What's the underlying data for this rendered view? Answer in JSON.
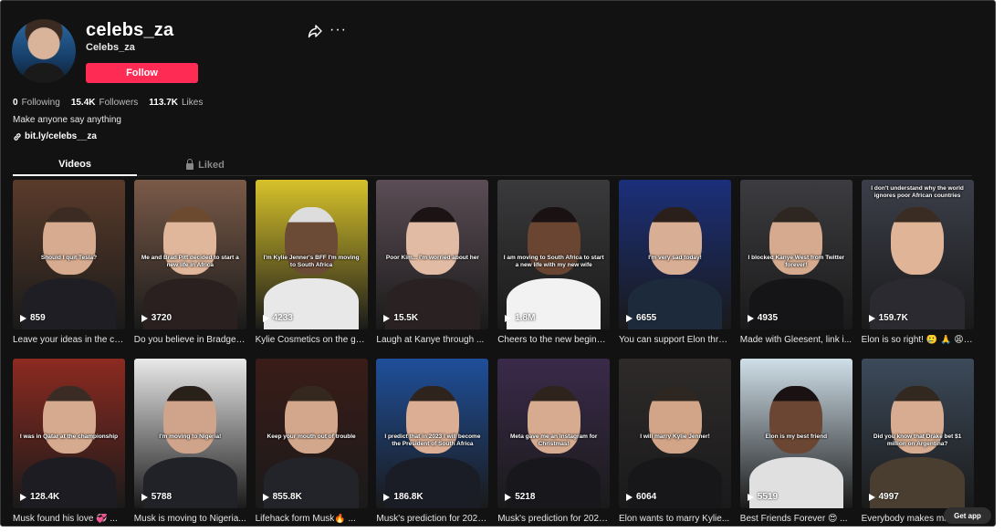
{
  "profile": {
    "username": "celebs_za",
    "nickname": "Celebs_za",
    "follow_label": "Follow",
    "following_count": "0",
    "following_label": "Following",
    "followers_count": "15.4K",
    "followers_label": "Followers",
    "likes_count": "113.7K",
    "likes_label": "Likes",
    "bio": "Make anyone say anything",
    "link": "bit.ly/celebs__za"
  },
  "tabs": {
    "videos": "Videos",
    "liked": "Liked"
  },
  "more_glyph": "···",
  "get_app": "Get app",
  "colors": {
    "accent": "#fe2c55",
    "background": "#121212"
  },
  "videos": [
    {
      "views": "859",
      "title": "Leave your ideas in the co...",
      "overlay": "Should I quit Tesla?",
      "bg": "#5a3b2a",
      "skin": "#d6ab90",
      "hair": "#3b2b22",
      "shirt": "#1e1e24"
    },
    {
      "views": "3720",
      "title": "Do you believe in Bradgeli...",
      "overlay": "Me and Brad Pitt decided to start a new life in Africa",
      "bg": "#7a5a48",
      "skin": "#e1b79b",
      "hair": "#6b4a30",
      "shirt": "#2a2020"
    },
    {
      "views": "4233",
      "title": "Kylie Cosmetics on the gol...",
      "overlay": "I'm Kylie Jenner's BFF I'm moving to South Africa",
      "bg": "#d7c22a",
      "skin": "#6b4a36",
      "hair": "#ddd",
      "shirt": "#e8e8e8"
    },
    {
      "views": "15.5K",
      "title": "Laugh at Kanye through ...",
      "overlay": "Poor Kim... I'm worried about her",
      "bg": "#5b4d55",
      "skin": "#e2bba4",
      "hair": "#1c1414",
      "shirt": "#2a2222"
    },
    {
      "views": "1.8M",
      "title": "Cheers to the new beginni...",
      "overlay": "I am moving to South Africa to start a new life with my new wife",
      "bg": "#3a3a3c",
      "skin": "#6a4632",
      "hair": "#1a1212",
      "shirt": "#f2f2f2"
    },
    {
      "views": "6655",
      "title": "You can support Elon thro...",
      "overlay": "I'm very sad today!",
      "bg": "#1b2f7a",
      "skin": "#d8ae95",
      "hair": "#2a1f1a",
      "shirt": "#1c2a3c"
    },
    {
      "views": "4935",
      "title": "Made with Gleesent, link i...",
      "overlay": "I blocked Kanye West from Twitter forever!",
      "bg": "#3c3c40",
      "skin": "#d5aa8f",
      "hair": "#2e2620",
      "shirt": "#151518"
    },
    {
      "views": "159.7K",
      "title": "Elon is so right! 🥲 🙏 😩 ...",
      "overlay": "I don't understand why the world ignores poor African countries",
      "bg": "#3c3f4a",
      "skin": "#e0b497",
      "hair": "#3a2c22",
      "shirt": "#2a2a30",
      "overlay_top": true
    },
    {
      "views": "128.4K",
      "title": "Musk found his love 💞 ...",
      "overlay": "I was in Qatar at the championship",
      "bg": "#8c2a20",
      "skin": "#d6aa8e",
      "hair": "#3a2c24",
      "shirt": "#1c1c22"
    },
    {
      "views": "5788",
      "title": "Musk is moving to Nigeria...",
      "overlay": "I'm moving to Nigeria!",
      "bg": "#e9e9ea",
      "skin": "#d0a48a",
      "hair": "#2a201a",
      "shirt": "#202228"
    },
    {
      "views": "855.8K",
      "title": "Lifehack form Musk🔥 ...",
      "overlay": "Keep your mouth out of trouble",
      "bg": "#3a1c18",
      "skin": "#d3a78c",
      "hair": "#35281f",
      "shirt": "#23232a"
    },
    {
      "views": "186.8K",
      "title": "Musk's prediction for 2023...",
      "overlay": "I predict that in 2023 I will become the President of South Africa",
      "bg": "#1f4f9a",
      "skin": "#dcae93",
      "hair": "#2e241d",
      "shirt": "#1b1d26"
    },
    {
      "views": "5218",
      "title": "Musk's prediction for 2023...",
      "overlay": "Meta gave me an Instagram for Christmas!",
      "bg": "#3a2a4a",
      "skin": "#d7ab8f",
      "hair": "#2e241d",
      "shirt": "#17171c"
    },
    {
      "views": "6064",
      "title": "Elon wants to marry Kylie...",
      "overlay": "I will marry Kylie Jenner!",
      "bg": "#2e2a2a",
      "skin": "#d2a588",
      "hair": "#2e2620",
      "shirt": "#17171a"
    },
    {
      "views": "5519",
      "title": "Best Friends Forever 😍 ...",
      "overlay": "Elon is my best friend",
      "bg": "#cfdfe8",
      "skin": "#6b4633",
      "hair": "#1a1212",
      "shirt": "#e0e0e0"
    },
    {
      "views": "4997",
      "title": "Everybody makes mis...",
      "overlay": "Did you know that Drake bet $1 million on Argentina?",
      "bg": "#3c4a5a",
      "skin": "#d8ac90",
      "hair": "#33281f",
      "shirt": "#4a3e30"
    }
  ]
}
